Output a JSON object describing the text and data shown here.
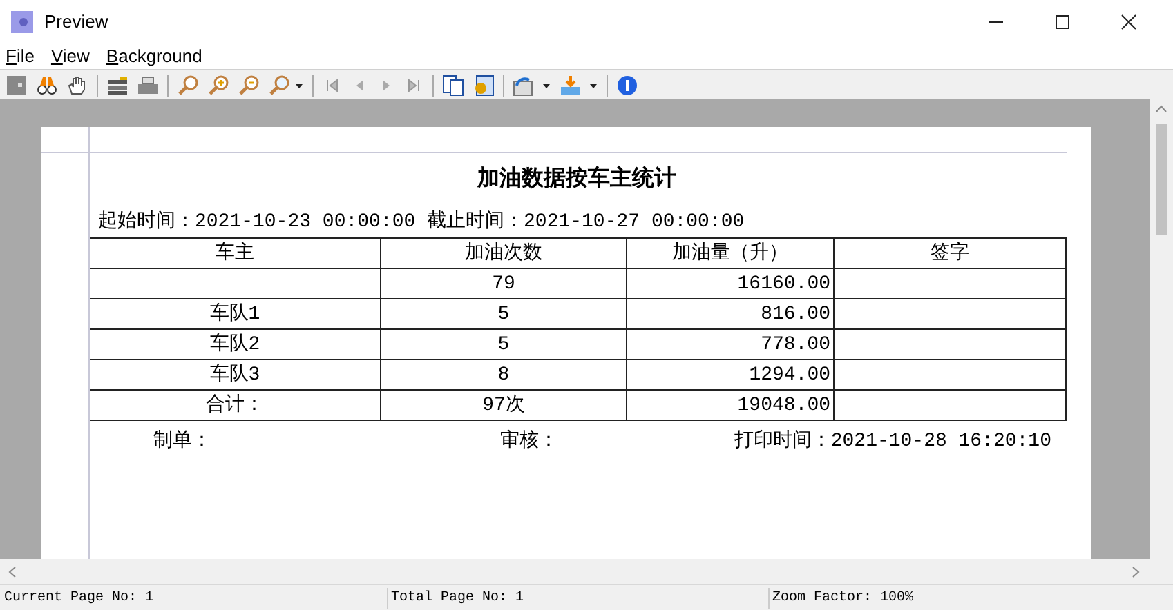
{
  "window": {
    "title": "Preview"
  },
  "menu": [
    {
      "label": "File"
    },
    {
      "label": "View"
    },
    {
      "label": "Background"
    }
  ],
  "report": {
    "title": "加油数据按车主统计",
    "date_range": "起始时间：2021-10-23 00:00:00 截止时间：2021-10-27 00:00:00",
    "columns": [
      "车主",
      "加油次数",
      "加油量（升）",
      "签字"
    ],
    "rows": [
      [
        "",
        "79",
        "16160.00",
        ""
      ],
      [
        "车队1",
        "5",
        "816.00",
        ""
      ],
      [
        "车队2",
        "5",
        "778.00",
        ""
      ],
      [
        "车队3",
        "8",
        "1294.00",
        ""
      ],
      [
        "合计：",
        "97次",
        "19048.00",
        ""
      ]
    ],
    "footer": [
      "制单：",
      "审核：",
      "打印时间：2021-10-28 16:20:10"
    ]
  },
  "status_bar": [
    "Current Page No: 1",
    "Total Page No: 1",
    "Zoom Factor: 100%"
  ]
}
